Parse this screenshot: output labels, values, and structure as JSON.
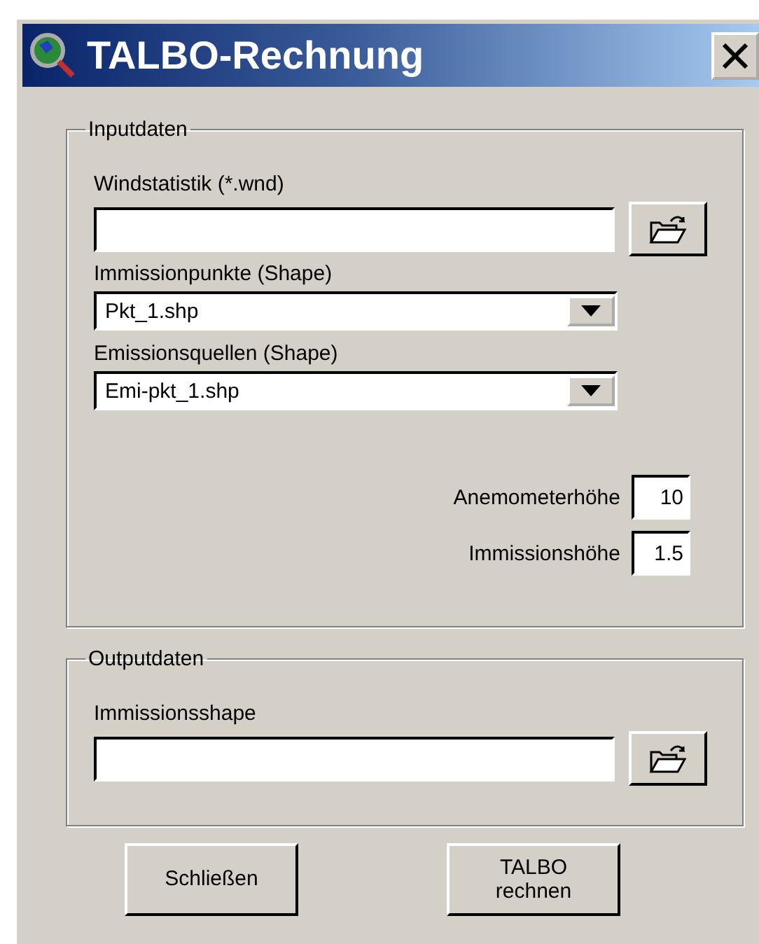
{
  "window": {
    "title": "TALBO-Rechnung"
  },
  "input_group": {
    "title": "Inputdaten",
    "wind_statistics": {
      "label": "Windstatistik (*.wnd)"
    },
    "immission_points": {
      "label": "Immissionpunkte (Shape)",
      "value": "Pkt_1.shp"
    },
    "emission_sources": {
      "label": "Emissionsquellen (Shape)",
      "value": "Emi-pkt_1.shp"
    },
    "heights": [
      {
        "label": "Anemometerhöhe",
        "value": "10"
      },
      {
        "label": "Immissionshöhe",
        "value": "1.5"
      }
    ]
  },
  "output_group": {
    "title": "Outputdaten",
    "immission_shape": {
      "label": "Immissionsshape"
    }
  },
  "buttons": [
    {
      "label": "Schließen"
    },
    {
      "label": "TALBO rechnen"
    }
  ]
}
